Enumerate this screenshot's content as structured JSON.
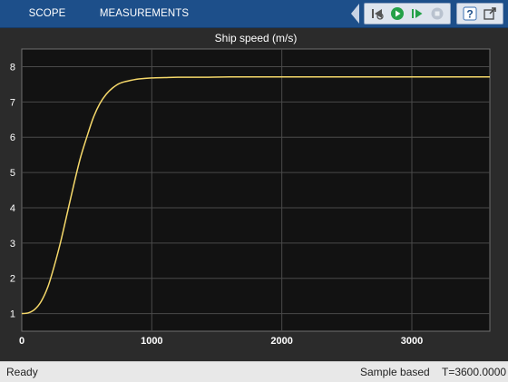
{
  "toolstrip": {
    "tabs": [
      {
        "label": "SCOPE"
      },
      {
        "label": "MEASUREMENTS"
      }
    ],
    "quick_access": [
      "back-arrow-icon",
      "step-back-icon",
      "run-icon",
      "step-forward-icon",
      "stop-icon",
      "help-icon",
      "undock-icon"
    ],
    "accent_color": "#1d4f8a"
  },
  "chart_data": {
    "type": "line",
    "title": "Ship speed (m/s)",
    "xlabel": "",
    "ylabel": "",
    "xlim": [
      0,
      3600
    ],
    "ylim": [
      0.5,
      8.5
    ],
    "x_ticks": [
      "0",
      "1000",
      "2000",
      "3000"
    ],
    "y_ticks": [
      "1",
      "2",
      "3",
      "4",
      "5",
      "6",
      "7",
      "8"
    ],
    "grid": true,
    "background": "#121212",
    "line_color": "#f5d86a",
    "series": [
      {
        "x": [
          0,
          50,
          100,
          150,
          200,
          250,
          300,
          350,
          400,
          450,
          500,
          550,
          600,
          650,
          700,
          750,
          800,
          850,
          900,
          1000,
          1100,
          1200,
          1400,
          1600,
          2000,
          2500,
          3000,
          3600
        ],
        "values": [
          1.0,
          1.02,
          1.12,
          1.35,
          1.75,
          2.35,
          3.05,
          3.85,
          4.65,
          5.4,
          6.0,
          6.55,
          6.95,
          7.22,
          7.4,
          7.52,
          7.58,
          7.62,
          7.65,
          7.68,
          7.69,
          7.7,
          7.7,
          7.71,
          7.71,
          7.71,
          7.71,
          7.71
        ]
      }
    ]
  },
  "status": {
    "left": "Ready",
    "mode": "Sample based",
    "time": "T=3600.0000"
  }
}
